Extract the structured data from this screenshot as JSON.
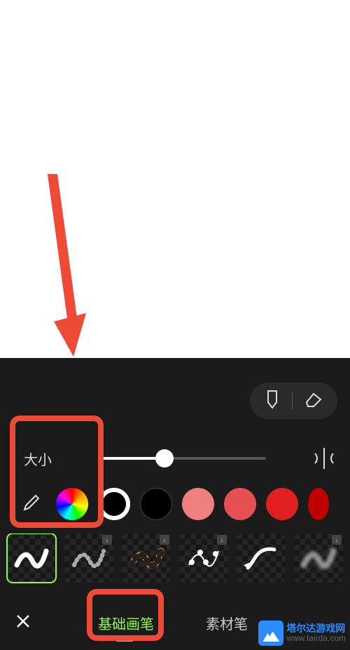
{
  "canvas": {},
  "annotation": {
    "arrow_color": "#ee4a36"
  },
  "toolbar": {
    "tool_a_icon": "brush-pen-icon",
    "tool_b_icon": "eraser-icon"
  },
  "size": {
    "label": "大小",
    "value_percent": 38
  },
  "mirror_icon": "symmetry-icon",
  "colors": {
    "eyedropper_icon": "eyedropper-icon",
    "wheel_icon": "color-wheel-icon",
    "swatches": [
      {
        "type": "ring",
        "color": "#ffffff"
      },
      {
        "type": "fill",
        "color": "#000000"
      },
      {
        "type": "fill",
        "color": "#f08080"
      },
      {
        "type": "fill",
        "color": "#e65050"
      },
      {
        "type": "fill",
        "color": "#e02020"
      },
      {
        "type": "fill",
        "color": "#c00000"
      }
    ]
  },
  "brushes": [
    {
      "name": "solid-stroke",
      "selected": true,
      "downloadable": false
    },
    {
      "name": "dotted-stroke",
      "selected": false,
      "downloadable": true
    },
    {
      "name": "tiger-stroke",
      "selected": false,
      "downloadable": true
    },
    {
      "name": "bead-stroke",
      "selected": false,
      "downloadable": true
    },
    {
      "name": "arrow-stroke",
      "selected": false,
      "downloadable": false
    },
    {
      "name": "spray-stroke",
      "selected": false,
      "downloadable": true
    }
  ],
  "tabs": {
    "close_icon": "close-icon",
    "items": [
      {
        "label": "基础画笔",
        "active": true
      },
      {
        "label": "素材笔",
        "active": false
      }
    ]
  },
  "watermark": {
    "title": "塔尔达游戏网",
    "url": "www.tairda.com"
  }
}
